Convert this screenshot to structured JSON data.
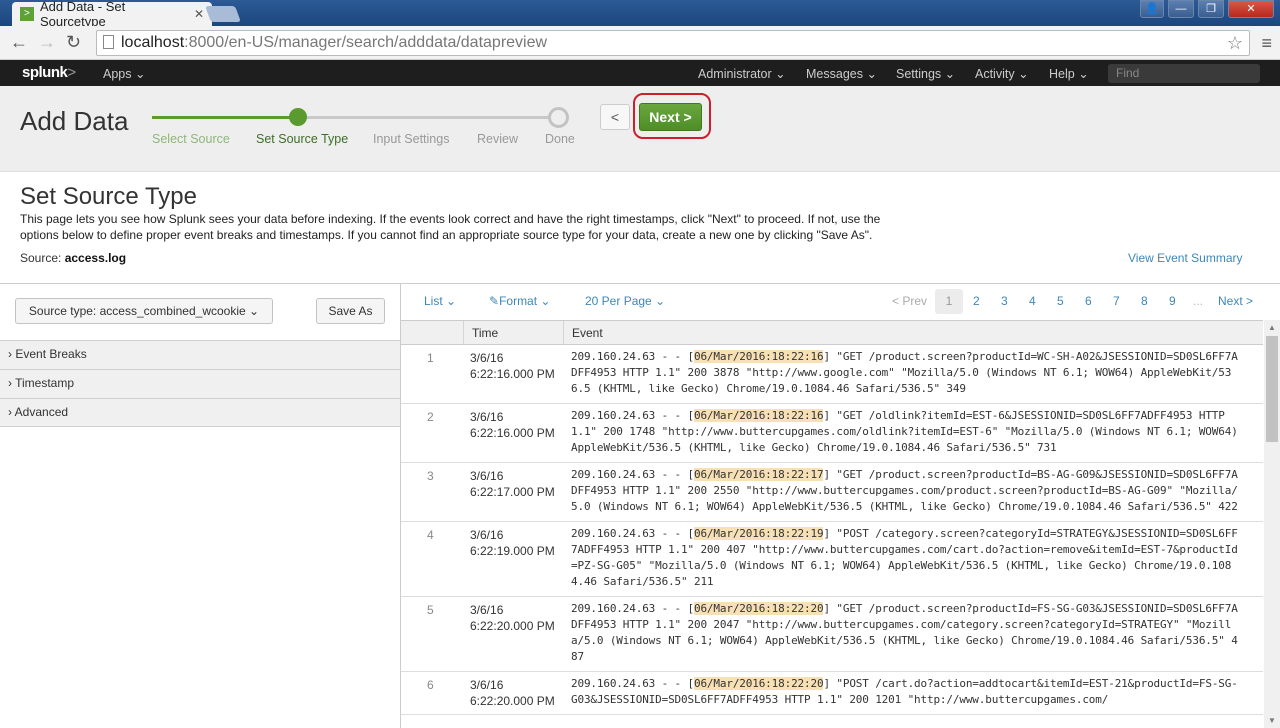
{
  "browser": {
    "tab_title": "Add Data - Set Sourcetype",
    "url_host": "localhost",
    "url_rest": ":8000/en-US/manager/search/adddata/datapreview"
  },
  "splunk_bar": {
    "logo": "splunk",
    "logo_suffix": ">",
    "apps": "Apps",
    "menus": [
      "Administrator",
      "Messages",
      "Settings",
      "Activity",
      "Help"
    ],
    "find_placeholder": "Find"
  },
  "header": {
    "title": "Add Data",
    "steps": [
      "Select Source",
      "Set Source Type",
      "Input Settings",
      "Review",
      "Done"
    ],
    "current_step": 2,
    "back_label": "<",
    "next_label": "Next >"
  },
  "page": {
    "title": "Set Source Type",
    "description": "This page lets you see how Splunk sees your data before indexing. If the events look correct and have the right timestamps, click \"Next\" to proceed. If not, use the options below to define proper event breaks and timestamps. If you cannot find an appropriate source type for your data, create a new one by clicking \"Save As\".",
    "source_label": "Source:",
    "source_value": "access.log",
    "view_summary": "View Event Summary"
  },
  "left_panel": {
    "sourcetype_label": "Source type: access_combined_wcookie",
    "save_as": "Save As",
    "sections": [
      "Event Breaks",
      "Timestamp",
      "Advanced"
    ]
  },
  "toolbar": {
    "list": "List",
    "format": "Format",
    "per_page": "20 Per Page",
    "prev": "< Prev",
    "pages": [
      "1",
      "2",
      "3",
      "4",
      "5",
      "6",
      "7",
      "8",
      "9"
    ],
    "current_page": "1",
    "ellipsis": "...",
    "next": "Next >"
  },
  "table": {
    "columns": [
      "",
      "Time",
      "Event"
    ],
    "rows": [
      {
        "n": "1",
        "date": "3/6/16",
        "time": "6:22:16.000 PM",
        "pre": "209.160.24.63 - - [",
        "ts": "06/Mar/2016:18:22:16",
        "post": "] \"GET /product.screen?productId=WC-SH-A02&JSESSIONID=SD0SL6FF7ADFF4953 HTTP 1.1\" 200 3878 \"http://www.google.com\" \"Mozilla/5.0 (Windows NT 6.1; WOW64) AppleWebKit/536.5 (KHTML, like Gecko) Chrome/19.0.1084.46 Safari/536.5\" 349"
      },
      {
        "n": "2",
        "date": "3/6/16",
        "time": "6:22:16.000 PM",
        "pre": "209.160.24.63 - - [",
        "ts": "06/Mar/2016:18:22:16",
        "post": "] \"GET /oldlink?itemId=EST-6&JSESSIONID=SD0SL6FF7ADFF4953 HTTP 1.1\" 200 1748 \"http://www.buttercupgames.com/oldlink?itemId=EST-6\" \"Mozilla/5.0 (Windows NT 6.1; WOW64) AppleWebKit/536.5 (KHTML, like Gecko) Chrome/19.0.1084.46 Safari/536.5\" 731"
      },
      {
        "n": "3",
        "date": "3/6/16",
        "time": "6:22:17.000 PM",
        "pre": "209.160.24.63 - - [",
        "ts": "06/Mar/2016:18:22:17",
        "post": "] \"GET /product.screen?productId=BS-AG-G09&JSESSIONID=SD0SL6FF7ADFF4953 HTTP 1.1\" 200 2550 \"http://www.buttercupgames.com/product.screen?productId=BS-AG-G09\" \"Mozilla/5.0 (Windows NT 6.1; WOW64) AppleWebKit/536.5 (KHTML, like Gecko) Chrome/19.0.1084.46 Safari/536.5\" 422"
      },
      {
        "n": "4",
        "date": "3/6/16",
        "time": "6:22:19.000 PM",
        "pre": "209.160.24.63 - - [",
        "ts": "06/Mar/2016:18:22:19",
        "post": "] \"POST /category.screen?categoryId=STRATEGY&JSESSIONID=SD0SL6FF7ADFF4953 HTTP 1.1\" 200 407 \"http://www.buttercupgames.com/cart.do?action=remove&itemId=EST-7&productId=PZ-SG-G05\" \"Mozilla/5.0 (Windows NT 6.1; WOW64) AppleWebKit/536.5 (KHTML, like Gecko) Chrome/19.0.1084.46 Safari/536.5\" 211"
      },
      {
        "n": "5",
        "date": "3/6/16",
        "time": "6:22:20.000 PM",
        "pre": "209.160.24.63 - - [",
        "ts": "06/Mar/2016:18:22:20",
        "post": "] \"GET /product.screen?productId=FS-SG-G03&JSESSIONID=SD0SL6FF7ADFF4953 HTTP 1.1\" 200 2047 \"http://www.buttercupgames.com/category.screen?categoryId=STRATEGY\" \"Mozilla/5.0 (Windows NT 6.1; WOW64) AppleWebKit/536.5 (KHTML, like Gecko) Chrome/19.0.1084.46 Safari/536.5\" 487"
      },
      {
        "n": "6",
        "date": "3/6/16",
        "time": "6:22:20.000 PM",
        "pre": "209.160.24.63 - - [",
        "ts": "06/Mar/2016:18:22:20",
        "post": "] \"POST /cart.do?action=addtocart&itemId=EST-21&productId=FS-SG-G03&JSESSIONID=SD0SL6FF7ADFF4953 HTTP 1.1\" 200 1201 \"http://www.buttercupgames.com/"
      }
    ]
  },
  "colors": {
    "accent_green": "#5a9a2f",
    "link_blue": "#3d87b8",
    "highlight": "#f7e0b4",
    "annotation_red": "#cc1f2b"
  }
}
